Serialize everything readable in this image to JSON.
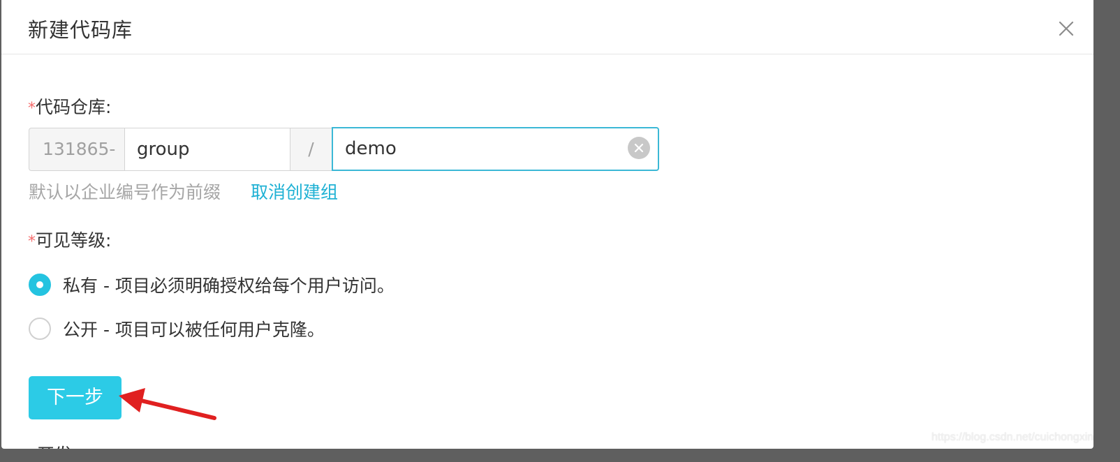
{
  "dialog": {
    "title": "新建代码库"
  },
  "repository": {
    "required_mark": "*",
    "label": "代码仓库:",
    "prefix": "131865-",
    "group_value": "group",
    "separator": "/",
    "repo_value": "demo",
    "hint": "默认以企业编号作为前缀",
    "cancel_group_link": "取消创建组"
  },
  "visibility": {
    "required_mark": "*",
    "label": "可见等级:",
    "options": [
      {
        "label": "私有 - 项目必须明确授权给每个用户访问。",
        "checked": true
      },
      {
        "label": "公开 - 项目可以被任何用户克隆。",
        "checked": false
      }
    ]
  },
  "actions": {
    "next_label": "下一步"
  },
  "cutoff_field": {
    "required_mark": "*",
    "label": "开发"
  },
  "annotation": {
    "arrow_color": "#e02020"
  },
  "watermark": "https://blog.csdn.net/cuichongxin",
  "colors": {
    "accent": "#2ccbe6",
    "link": "#1fb1d4",
    "required": "#f56c6c",
    "focus_border": "#3bb8d6"
  },
  "icons": {
    "close": "close-icon",
    "clear": "clear-icon",
    "arrow": "red-arrow-annotation"
  }
}
